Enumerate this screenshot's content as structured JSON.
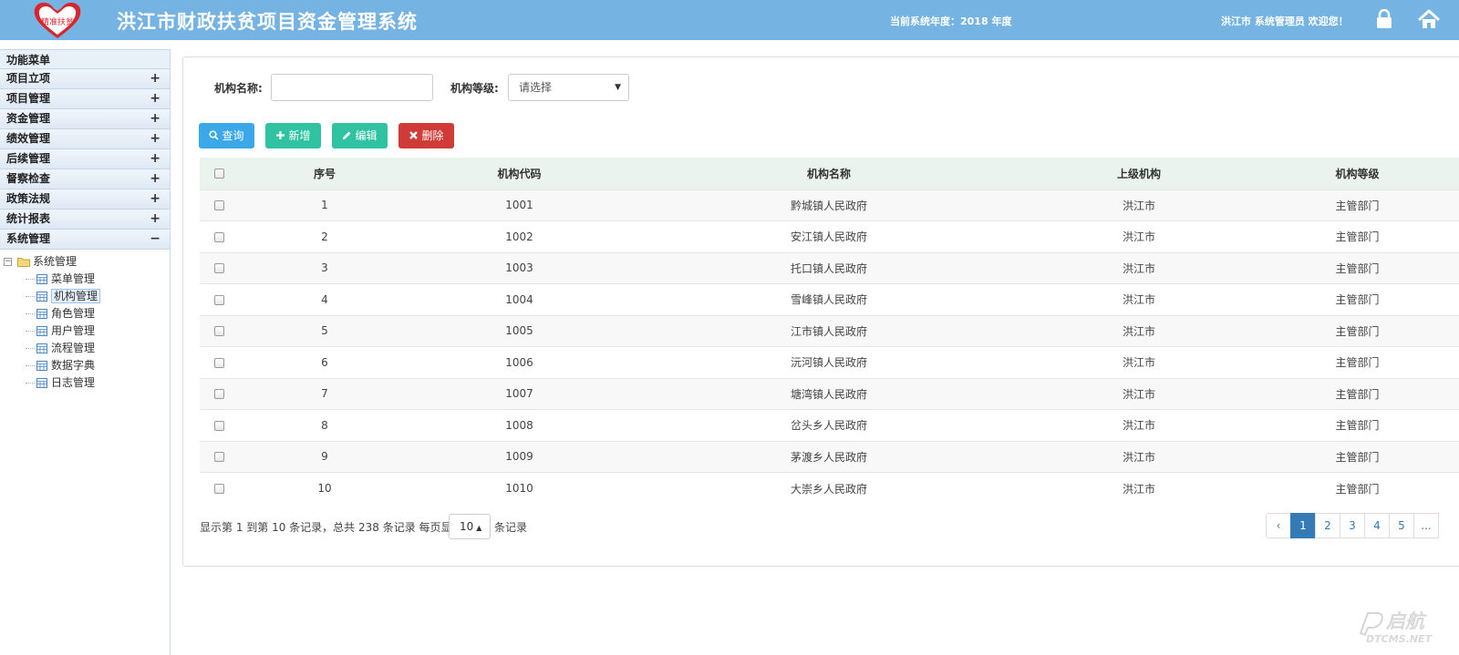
{
  "header": {
    "logo_text": "精准扶贫",
    "app_title": "洪江市财政扶贫项目资金管理系统",
    "year_label": "当前系统年度：2018 年度",
    "welcome": "洪江市 系统管理员 欢迎您！",
    "lock_icon": "lock-icon",
    "home_icon": "home-icon"
  },
  "sidebar": {
    "title": "功能菜单",
    "items": [
      {
        "label": "项目立项",
        "toggle": "+"
      },
      {
        "label": "项目管理",
        "toggle": "+"
      },
      {
        "label": "资金管理",
        "toggle": "+"
      },
      {
        "label": "绩效管理",
        "toggle": "+"
      },
      {
        "label": "后续管理",
        "toggle": "+"
      },
      {
        "label": "督察检查",
        "toggle": "+"
      },
      {
        "label": "政策法规",
        "toggle": "+"
      },
      {
        "label": "统计报表",
        "toggle": "+"
      },
      {
        "label": "系统管理",
        "toggle": "−"
      }
    ],
    "tree": {
      "root": "系统管理",
      "children": [
        "菜单管理",
        "机构管理",
        "角色管理",
        "用户管理",
        "流程管理",
        "数据字典",
        "日志管理"
      ],
      "active": "机构管理"
    }
  },
  "search": {
    "name_label": "机构名称:",
    "name_value": "",
    "level_label": "机构等级:",
    "level_selected": "请选择"
  },
  "toolbar": {
    "query": "查询",
    "add": "新增",
    "edit": "编辑",
    "delete": "删除"
  },
  "table": {
    "headers": [
      "序号",
      "机构代码",
      "机构名称",
      "上级机构",
      "机构等级"
    ],
    "rows": [
      [
        "1",
        "1001",
        "黔城镇人民政府",
        "洪江市",
        "主管部门"
      ],
      [
        "2",
        "1002",
        "安江镇人民政府",
        "洪江市",
        "主管部门"
      ],
      [
        "3",
        "1003",
        "托口镇人民政府",
        "洪江市",
        "主管部门"
      ],
      [
        "4",
        "1004",
        "雪峰镇人民政府",
        "洪江市",
        "主管部门"
      ],
      [
        "5",
        "1005",
        "江市镇人民政府",
        "洪江市",
        "主管部门"
      ],
      [
        "6",
        "1006",
        "沅河镇人民政府",
        "洪江市",
        "主管部门"
      ],
      [
        "7",
        "1007",
        "塘湾镇人民政府",
        "洪江市",
        "主管部门"
      ],
      [
        "8",
        "1008",
        "岔头乡人民政府",
        "洪江市",
        "主管部门"
      ],
      [
        "9",
        "1009",
        "茅渡乡人民政府",
        "洪江市",
        "主管部门"
      ],
      [
        "10",
        "1010",
        "大崇乡人民政府",
        "洪江市",
        "主管部门"
      ]
    ]
  },
  "pagination": {
    "info": "显示第 1 到第 10 条记录，总共 238 条记录 每页显示",
    "page_size": "10",
    "suffix": "条记录",
    "prev": "‹",
    "pages": [
      "1",
      "2",
      "3",
      "4",
      "5",
      "..."
    ],
    "current": "1"
  },
  "watermark": {
    "text": "启航",
    "sub": "DTCMS.NET"
  },
  "colors": {
    "header_bg": "#74b3e2",
    "query_btn": "#3ba8ea",
    "add_btn": "#2fc3a1",
    "delete_btn": "#d03a37",
    "pager_active": "#337ab7"
  }
}
